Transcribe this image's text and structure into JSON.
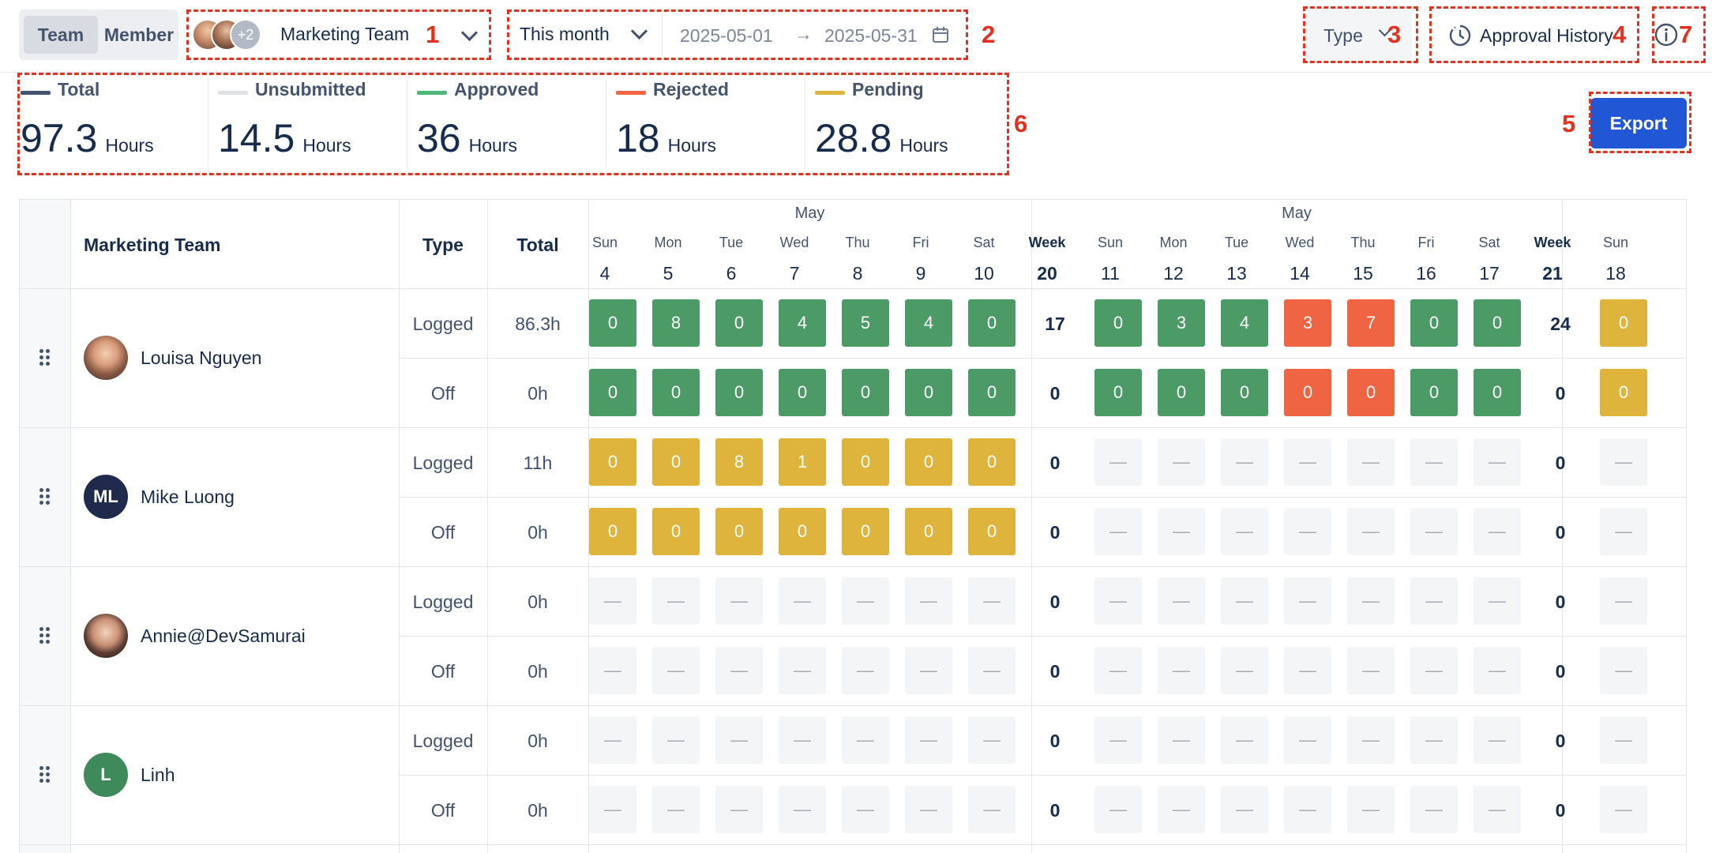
{
  "toolbar": {
    "view_toggle": [
      "Team",
      "Member"
    ],
    "avatar_extra": "+2",
    "team_select": "Marketing Team",
    "period_select": "This month",
    "date_from": "2025-05-01",
    "date_arrow": "→",
    "date_to": "2025-05-31",
    "type_filter": "Type",
    "approval_history": "Approval History",
    "export": "Export"
  },
  "annotations": [
    "1",
    "2",
    "3",
    "4",
    "5",
    "6",
    "7"
  ],
  "summary": [
    {
      "label": "Total",
      "value": "97.3",
      "unit": "Hours",
      "color": "#44546f"
    },
    {
      "label": "Unsubmitted",
      "value": "14.5",
      "unit": "Hours",
      "color": "#dfe1e6"
    },
    {
      "label": "Approved",
      "value": "36",
      "unit": "Hours",
      "color": "#4bb878"
    },
    {
      "label": "Rejected",
      "value": "18",
      "unit": "Hours",
      "color": "#ef6544"
    },
    {
      "label": "Pending",
      "value": "28.8",
      "unit": "Hours",
      "color": "#dfb43c"
    }
  ],
  "table": {
    "team_header": "Marketing Team",
    "type_header": "Type",
    "total_header": "Total",
    "months": [
      "May",
      "May"
    ],
    "days": [
      {
        "dow": "Sun",
        "num": "4"
      },
      {
        "dow": "Mon",
        "num": "5"
      },
      {
        "dow": "Tue",
        "num": "6"
      },
      {
        "dow": "Wed",
        "num": "7"
      },
      {
        "dow": "Thu",
        "num": "8"
      },
      {
        "dow": "Fri",
        "num": "9"
      },
      {
        "dow": "Sat",
        "num": "10"
      },
      {
        "dow": "Week",
        "num": "20",
        "week": true
      },
      {
        "dow": "Sun",
        "num": "11"
      },
      {
        "dow": "Mon",
        "num": "12"
      },
      {
        "dow": "Tue",
        "num": "13"
      },
      {
        "dow": "Wed",
        "num": "14"
      },
      {
        "dow": "Thu",
        "num": "15"
      },
      {
        "dow": "Fri",
        "num": "16"
      },
      {
        "dow": "Sat",
        "num": "17"
      },
      {
        "dow": "Week",
        "num": "21",
        "week": true
      },
      {
        "dow": "Sun",
        "num": "18"
      }
    ],
    "members": [
      {
        "name": "Louisa Nguyen",
        "avatar": "photo",
        "rows": [
          {
            "type": "Logged",
            "total": "86.3h",
            "cells": [
              [
                "0",
                "g"
              ],
              [
                "8",
                "g"
              ],
              [
                "0",
                "g"
              ],
              [
                "4",
                "g"
              ],
              [
                "5",
                "g"
              ],
              [
                "4",
                "g"
              ],
              [
                "0",
                "g"
              ],
              [
                "17",
                "w"
              ],
              [
                "0",
                "g"
              ],
              [
                "3",
                "g"
              ],
              [
                "4",
                "g"
              ],
              [
                "3",
                "r"
              ],
              [
                "7",
                "r"
              ],
              [
                "0",
                "g"
              ],
              [
                "0",
                "g"
              ],
              [
                "24",
                "w"
              ],
              [
                "0",
                "y"
              ]
            ]
          },
          {
            "type": "Off",
            "total": "0h",
            "cells": [
              [
                "0",
                "g"
              ],
              [
                "0",
                "g"
              ],
              [
                "0",
                "g"
              ],
              [
                "0",
                "g"
              ],
              [
                "0",
                "g"
              ],
              [
                "0",
                "g"
              ],
              [
                "0",
                "g"
              ],
              [
                "0",
                "w"
              ],
              [
                "0",
                "g"
              ],
              [
                "0",
                "g"
              ],
              [
                "0",
                "g"
              ],
              [
                "0",
                "r"
              ],
              [
                "0",
                "r"
              ],
              [
                "0",
                "g"
              ],
              [
                "0",
                "g"
              ],
              [
                "0",
                "w"
              ],
              [
                "0",
                "y"
              ]
            ]
          }
        ]
      },
      {
        "name": "Mike Luong",
        "avatar": "ML",
        "avatar_color": "#1f2a4d",
        "rows": [
          {
            "type": "Logged",
            "total": "11h",
            "cells": [
              [
                "0",
                "y"
              ],
              [
                "0",
                "y"
              ],
              [
                "8",
                "y"
              ],
              [
                "1",
                "y"
              ],
              [
                "0",
                "y"
              ],
              [
                "0",
                "y"
              ],
              [
                "0",
                "y"
              ],
              [
                "0",
                "w"
              ],
              [
                "—",
                "e"
              ],
              [
                "—",
                "e"
              ],
              [
                "—",
                "e"
              ],
              [
                "—",
                "e"
              ],
              [
                "—",
                "e"
              ],
              [
                "—",
                "e"
              ],
              [
                "—",
                "e"
              ],
              [
                "0",
                "w"
              ],
              [
                "—",
                "e"
              ]
            ]
          },
          {
            "type": "Off",
            "total": "0h",
            "cells": [
              [
                "0",
                "y"
              ],
              [
                "0",
                "y"
              ],
              [
                "0",
                "y"
              ],
              [
                "0",
                "y"
              ],
              [
                "0",
                "y"
              ],
              [
                "0",
                "y"
              ],
              [
                "0",
                "y"
              ],
              [
                "0",
                "w"
              ],
              [
                "—",
                "e"
              ],
              [
                "—",
                "e"
              ],
              [
                "—",
                "e"
              ],
              [
                "—",
                "e"
              ],
              [
                "—",
                "e"
              ],
              [
                "—",
                "e"
              ],
              [
                "—",
                "e"
              ],
              [
                "0",
                "w"
              ],
              [
                "—",
                "e"
              ]
            ]
          }
        ]
      },
      {
        "name": "Annie@DevSamurai",
        "avatar": "photo",
        "rows": [
          {
            "type": "Logged",
            "total": "0h",
            "cells": [
              [
                "—",
                "e"
              ],
              [
                "—",
                "e"
              ],
              [
                "—",
                "e"
              ],
              [
                "—",
                "e"
              ],
              [
                "—",
                "e"
              ],
              [
                "—",
                "e"
              ],
              [
                "—",
                "e"
              ],
              [
                "0",
                "w"
              ],
              [
                "—",
                "e"
              ],
              [
                "—",
                "e"
              ],
              [
                "—",
                "e"
              ],
              [
                "—",
                "e"
              ],
              [
                "—",
                "e"
              ],
              [
                "—",
                "e"
              ],
              [
                "—",
                "e"
              ],
              [
                "0",
                "w"
              ],
              [
                "—",
                "e"
              ]
            ]
          },
          {
            "type": "Off",
            "total": "0h",
            "cells": [
              [
                "—",
                "e"
              ],
              [
                "—",
                "e"
              ],
              [
                "—",
                "e"
              ],
              [
                "—",
                "e"
              ],
              [
                "—",
                "e"
              ],
              [
                "—",
                "e"
              ],
              [
                "—",
                "e"
              ],
              [
                "0",
                "w"
              ],
              [
                "—",
                "e"
              ],
              [
                "—",
                "e"
              ],
              [
                "—",
                "e"
              ],
              [
                "—",
                "e"
              ],
              [
                "—",
                "e"
              ],
              [
                "—",
                "e"
              ],
              [
                "—",
                "e"
              ],
              [
                "0",
                "w"
              ],
              [
                "—",
                "e"
              ]
            ]
          }
        ]
      },
      {
        "name": "Linh",
        "avatar": "L",
        "avatar_color": "#3e8a5a",
        "rows": [
          {
            "type": "Logged",
            "total": "0h",
            "cells": [
              [
                "—",
                "e"
              ],
              [
                "—",
                "e"
              ],
              [
                "—",
                "e"
              ],
              [
                "—",
                "e"
              ],
              [
                "—",
                "e"
              ],
              [
                "—",
                "e"
              ],
              [
                "—",
                "e"
              ],
              [
                "0",
                "w"
              ],
              [
                "—",
                "e"
              ],
              [
                "—",
                "e"
              ],
              [
                "—",
                "e"
              ],
              [
                "—",
                "e"
              ],
              [
                "—",
                "e"
              ],
              [
                "—",
                "e"
              ],
              [
                "—",
                "e"
              ],
              [
                "0",
                "w"
              ],
              [
                "—",
                "e"
              ]
            ]
          },
          {
            "type": "Off",
            "total": "0h",
            "cells": [
              [
                "—",
                "e"
              ],
              [
                "—",
                "e"
              ],
              [
                "—",
                "e"
              ],
              [
                "—",
                "e"
              ],
              [
                "—",
                "e"
              ],
              [
                "—",
                "e"
              ],
              [
                "—",
                "e"
              ],
              [
                "0",
                "w"
              ],
              [
                "—",
                "e"
              ],
              [
                "—",
                "e"
              ],
              [
                "—",
                "e"
              ],
              [
                "—",
                "e"
              ],
              [
                "—",
                "e"
              ],
              [
                "—",
                "e"
              ],
              [
                "—",
                "e"
              ],
              [
                "0",
                "w"
              ],
              [
                "—",
                "e"
              ]
            ]
          }
        ]
      }
    ]
  }
}
